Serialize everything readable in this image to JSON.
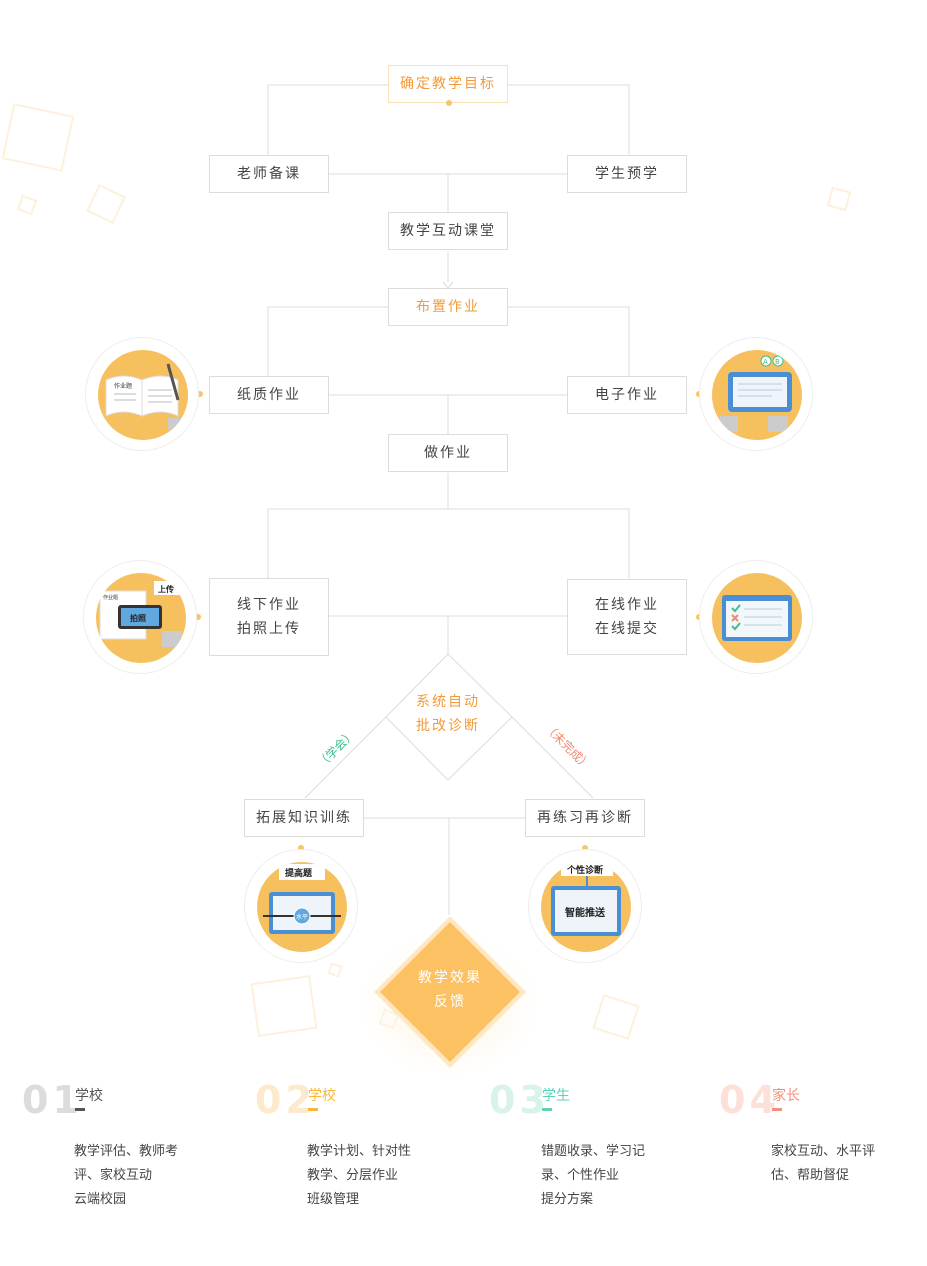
{
  "nodes": {
    "goal": "确定教学目标",
    "teacher_prep": "老师备课",
    "student_preview": "学生预学",
    "interactive_class": "教学互动课堂",
    "assign_homework": "布置作业",
    "paper_homework": "纸质作业",
    "electronic_homework": "电子作业",
    "do_homework": "做作业",
    "offline_line1": "线下作业",
    "offline_line2": "拍照上传",
    "online_line1": "在线作业",
    "online_line2": "在线提交",
    "system_line1": "系统自动",
    "system_line2": "批改诊断",
    "branch_learned": "（学会）",
    "branch_unfinished": "（未完成）",
    "extend_training": "拓展知识训练",
    "repractice": "再练习再诊断",
    "feedback_line1": "教学效果",
    "feedback_line2": "反馈"
  },
  "illustrations": {
    "paper_book": "作业题",
    "photo_label": "作业题",
    "photo_upload": "上传",
    "photo_button": "拍照",
    "electronic_badges": [
      "A",
      "B"
    ],
    "improve_title": "提高题",
    "improve_level": "水平",
    "diag_title": "个性诊断",
    "diag_button": "智能推送"
  },
  "features": [
    {
      "num": "01",
      "title": "学校",
      "color": "#555555",
      "num_color": "#dcdcdc",
      "desc": [
        "教学评估、教师考",
        "评、家校互动",
        "云端校园"
      ]
    },
    {
      "num": "02",
      "title": "学校",
      "color": "#f7b63c",
      "num_color": "#fde9cc",
      "desc": [
        "教学计划、针对性",
        "教学、分层作业",
        "班级管理"
      ]
    },
    {
      "num": "03",
      "title": "学生",
      "color": "#5ed1b7",
      "num_color": "#d7f3ec",
      "desc": [
        "错题收录、学习记",
        "录、个性作业",
        "提分方案"
      ]
    },
    {
      "num": "04",
      "title": "家长",
      "color": "#f4907a",
      "num_color": "#fde0d8",
      "desc": [
        "家校互动、水平评",
        "估、帮助督促"
      ]
    }
  ],
  "colors": {
    "accent_orange": "#f29b3a",
    "illustration_yellow": "#f6c05e",
    "learned_green": "#3fbf8a",
    "unfinished_red": "#f08a6b",
    "line_gray": "#dcdcdc"
  }
}
